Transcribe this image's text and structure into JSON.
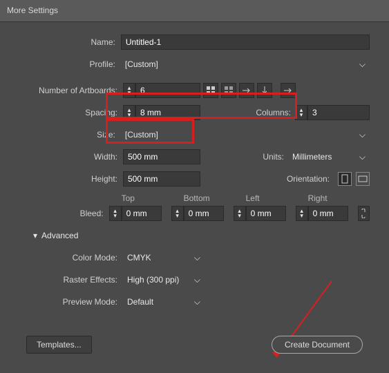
{
  "title": "More Settings",
  "labels": {
    "name": "Name:",
    "profile": "Profile:",
    "artboards": "Number of Artboards:",
    "spacing": "Spacing:",
    "columns": "Columns:",
    "size": "Size:",
    "width": "Width:",
    "units": "Units:",
    "height": "Height:",
    "orientation": "Orientation:",
    "bleed": "Bleed:",
    "top": "Top",
    "bottom": "Bottom",
    "left": "Left",
    "right": "Right",
    "advanced": "Advanced",
    "colorMode": "Color Mode:",
    "rasterEffects": "Raster Effects:",
    "previewMode": "Preview Mode:"
  },
  "values": {
    "name": "Untitled-1",
    "profile": "[Custom]",
    "artboards": "6",
    "spacing": "8 mm",
    "columns": "3",
    "size": "[Custom]",
    "width": "500 mm",
    "units": "Millimeters",
    "height": "500 mm",
    "bleedTop": "0 mm",
    "bleedBottom": "0 mm",
    "bleedLeft": "0 mm",
    "bleedRight": "0 mm",
    "colorMode": "CMYK",
    "rasterEffects": "High (300 ppi)",
    "previewMode": "Default"
  },
  "buttons": {
    "templates": "Templates...",
    "create": "Create Document"
  },
  "icons": {
    "gridByRow": "grid-by-row-icon",
    "gridByCol": "grid-by-column-icon",
    "rowLR": "arrange-row-lr-icon",
    "rowRL": "arrange-row-rl-icon",
    "column": "arrange-column-icon",
    "arrowRight": "arrow-right-icon",
    "portrait": "portrait-icon",
    "landscape": "landscape-icon",
    "link": "link-icon"
  }
}
